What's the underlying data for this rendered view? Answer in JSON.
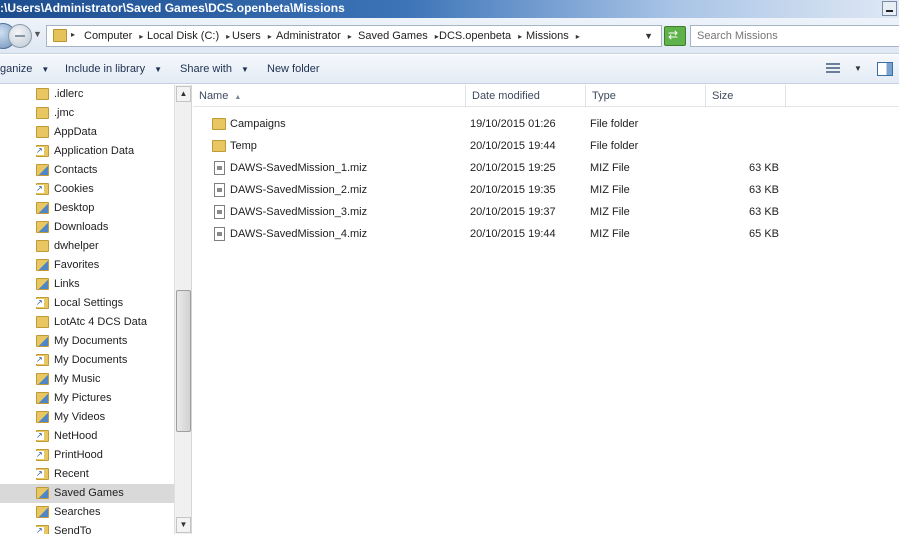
{
  "window": {
    "title": ":\\Users\\Administrator\\Saved Games\\DCS.openbeta\\Missions"
  },
  "address": {
    "crumbs": [
      "Computer",
      "Local Disk (C:)",
      "Users",
      "Administrator",
      "Saved Games",
      "DCS.openbeta",
      "Missions"
    ],
    "search_placeholder": "Search Missions"
  },
  "toolbar": {
    "organize": "ganize",
    "include": "Include in library",
    "share": "Share with",
    "new_folder": "New folder"
  },
  "nav": {
    "items": [
      {
        "label": ".idlerc",
        "icon": "folder-icon"
      },
      {
        "label": ".jmc",
        "icon": "folder-icon"
      },
      {
        "label": "AppData",
        "icon": "folder-icon"
      },
      {
        "label": "Application Data",
        "icon": "shortcut-folder-icon"
      },
      {
        "label": "Contacts",
        "icon": "contacts-folder-icon"
      },
      {
        "label": "Cookies",
        "icon": "shortcut-folder-icon"
      },
      {
        "label": "Desktop",
        "icon": "desktop-folder-icon"
      },
      {
        "label": "Downloads",
        "icon": "downloads-folder-icon"
      },
      {
        "label": "dwhelper",
        "icon": "folder-icon"
      },
      {
        "label": "Favorites",
        "icon": "favorites-folder-icon"
      },
      {
        "label": "Links",
        "icon": "links-folder-icon"
      },
      {
        "label": "Local Settings",
        "icon": "shortcut-folder-icon"
      },
      {
        "label": "LotAtc 4 DCS Data",
        "icon": "folder-icon"
      },
      {
        "label": "My Documents",
        "icon": "documents-folder-icon"
      },
      {
        "label": "My Documents",
        "icon": "shortcut-folder-icon"
      },
      {
        "label": "My Music",
        "icon": "music-folder-icon"
      },
      {
        "label": "My Pictures",
        "icon": "pictures-folder-icon"
      },
      {
        "label": "My Videos",
        "icon": "videos-folder-icon"
      },
      {
        "label": "NetHood",
        "icon": "shortcut-folder-icon"
      },
      {
        "label": "PrintHood",
        "icon": "shortcut-folder-icon"
      },
      {
        "label": "Recent",
        "icon": "shortcut-folder-icon"
      },
      {
        "label": "Saved Games",
        "icon": "saved-games-folder-icon",
        "selected": true
      },
      {
        "label": "Searches",
        "icon": "searches-folder-icon"
      },
      {
        "label": "SendTo",
        "icon": "shortcut-folder-icon"
      }
    ]
  },
  "columns": {
    "name": "Name",
    "date": "Date modified",
    "type": "Type",
    "size": "Size"
  },
  "files": [
    {
      "name": "Campaigns",
      "date": "19/10/2015 01:26",
      "type": "File folder",
      "size": "",
      "kind": "folder"
    },
    {
      "name": "Temp",
      "date": "20/10/2015 19:44",
      "type": "File folder",
      "size": "",
      "kind": "folder"
    },
    {
      "name": "DAWS-SavedMission_1.miz",
      "date": "20/10/2015 19:25",
      "type": "MIZ File",
      "size": "63 KB",
      "kind": "file"
    },
    {
      "name": "DAWS-SavedMission_2.miz",
      "date": "20/10/2015 19:35",
      "type": "MIZ File",
      "size": "63 KB",
      "kind": "file"
    },
    {
      "name": "DAWS-SavedMission_3.miz",
      "date": "20/10/2015 19:37",
      "type": "MIZ File",
      "size": "63 KB",
      "kind": "file"
    },
    {
      "name": "DAWS-SavedMission_4.miz",
      "date": "20/10/2015 19:44",
      "type": "MIZ File",
      "size": "65 KB",
      "kind": "file"
    }
  ]
}
